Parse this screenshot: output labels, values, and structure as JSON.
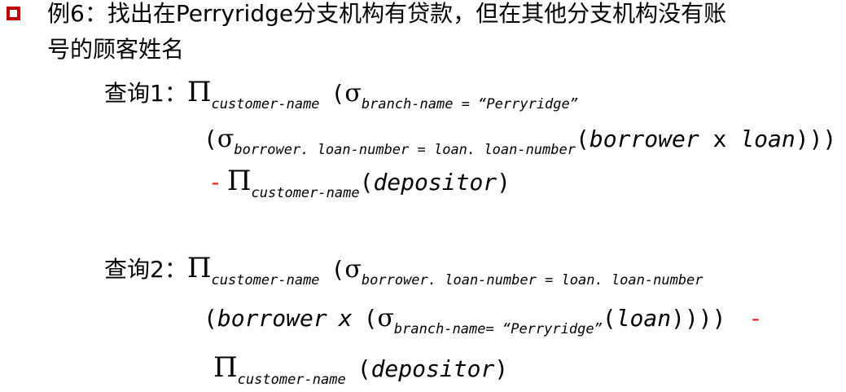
{
  "title": {
    "line1": "例6：找出在Perryridge分支机构有贷款，但在其他分支机构没有账",
    "line2": "号的顾客姓名"
  },
  "query1": {
    "label": "查询1：",
    "l1_pi": "Π",
    "l1_pi_sub": "customer-name",
    "l1_open": "(",
    "l1_sigma": "σ",
    "l1_sigma_sub": "branch-name = “Perryridge”",
    "l2_open": "(",
    "l2_sigma": "σ",
    "l2_sigma_sub": "borrower. loan-number = loan. loan-number",
    "l2_open2": "(",
    "l2_rel1": "borrower",
    "l2_x": " x ",
    "l2_rel2": "loan",
    "l2_close": ")))",
    "l3_minus": "-",
    "l3_pi": "Π",
    "l3_pi_sub": "customer-name",
    "l3_open": "(",
    "l3_rel": "depositor",
    "l3_close": ")"
  },
  "query2": {
    "label": "查询2：",
    "l1_pi": "Π",
    "l1_pi_sub": "customer-name",
    "l1_open": "(",
    "l1_sigma": "σ",
    "l1_sigma_sub": "borrower. loan-number = loan. loan-number",
    "l2_open": "(",
    "l2_rel1": "borrower",
    "l2_x": "x",
    "l2_open2": "(",
    "l2_sigma": "σ",
    "l2_sigma_sub": "branch-name= “Perryridge”",
    "l2_open3": "(",
    "l2_rel2": "loan",
    "l2_close": "))))",
    "l2_minus": "-",
    "l3_pi": "Π",
    "l3_pi_sub": "customer-name",
    "l3_open": "(",
    "l3_rel": "depositor",
    "l3_close": ")"
  },
  "colors": {
    "bullet": "#c00000",
    "minus": "#e0201a",
    "text": "#000000"
  }
}
